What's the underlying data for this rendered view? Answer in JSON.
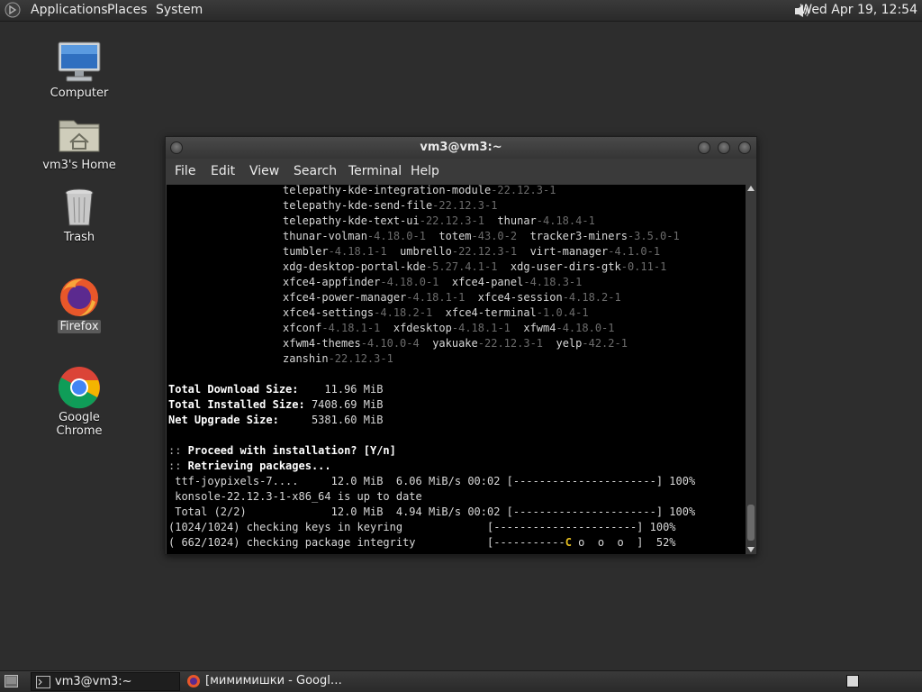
{
  "top_panel": {
    "menus": [
      "Applications",
      "Places",
      "System"
    ],
    "clock": "Wed Apr 19, 12:54",
    "icons": {
      "apps": "gnome-foot-icon",
      "volume": "speaker-icon"
    }
  },
  "desktop": {
    "icons": [
      {
        "label": "Computer",
        "icon": "computer-icon"
      },
      {
        "label": "vm3's Home",
        "icon": "home-folder-icon"
      },
      {
        "label": "Trash",
        "icon": "trash-icon"
      },
      {
        "label": "Firefox",
        "icon": "firefox-icon"
      },
      {
        "label": "Google Chrome",
        "icon": "chrome-icon"
      }
    ]
  },
  "window": {
    "title": "vm3@vm3:~",
    "menu": [
      "File",
      "Edit",
      "View",
      "Search",
      "Terminal",
      "Help"
    ],
    "package_lines": [
      [
        [
          "telepathy-kde-integration-module",
          "-22.12.3-1"
        ]
      ],
      [
        [
          "telepathy-kde-send-file",
          "-22.12.3-1"
        ]
      ],
      [
        [
          "telepathy-kde-text-ui",
          "-22.12.3-1"
        ],
        [
          "thunar",
          "-4.18.4-1"
        ]
      ],
      [
        [
          "thunar-volman",
          "-4.18.0-1"
        ],
        [
          "totem",
          "-43.0-2"
        ],
        [
          "tracker3-miners",
          "-3.5.0-1"
        ]
      ],
      [
        [
          "tumbler",
          "-4.18.1-1"
        ],
        [
          "umbrello",
          "-22.12.3-1"
        ],
        [
          "virt-manager",
          "-4.1.0-1"
        ]
      ],
      [
        [
          "xdg-desktop-portal-kde",
          "-5.27.4.1-1"
        ],
        [
          "xdg-user-dirs-gtk",
          "-0.11-1"
        ]
      ],
      [
        [
          "xfce4-appfinder",
          "-4.18.0-1"
        ],
        [
          "xfce4-panel",
          "-4.18.3-1"
        ]
      ],
      [
        [
          "xfce4-power-manager",
          "-4.18.1-1"
        ],
        [
          "xfce4-session",
          "-4.18.2-1"
        ]
      ],
      [
        [
          "xfce4-settings",
          "-4.18.2-1"
        ],
        [
          "xfce4-terminal",
          "-1.0.4-1"
        ]
      ],
      [
        [
          "xfconf",
          "-4.18.1-1"
        ],
        [
          "xfdesktop",
          "-4.18.1-1"
        ],
        [
          "xfwm4",
          "-4.18.0-1"
        ]
      ],
      [
        [
          "xfwm4-themes",
          "-4.10.0-4"
        ],
        [
          "yakuake",
          "-22.12.3-1"
        ],
        [
          "yelp",
          "-42.2-1"
        ]
      ],
      [
        [
          "zanshin",
          "-22.12.3-1"
        ]
      ]
    ],
    "sizes": [
      {
        "label": "Total Download Size:",
        "value": "    11.96 MiB"
      },
      {
        "label": "Total Installed Size:",
        "value": " 7408.69 MiB"
      },
      {
        "label": "Net Upgrade Size:",
        "value": "     5381.60 MiB"
      }
    ],
    "prompt": {
      "marker": "::",
      "text": " Proceed with installation? [Y/n]"
    },
    "retrieving": {
      "marker": "::",
      "text": " Retrieving packages..."
    },
    "progress_lines": [
      {
        "text": " ttf-joypixels-7....     12.0 MiB  6.06 MiB/s 00:02 [----------------------] 100%"
      },
      {
        "text": " konsole-22.12.3-1-x86_64 is up to date"
      },
      {
        "text": " Total (2/2)             12.0 MiB  4.94 MiB/s 00:02 [----------------------] 100%"
      },
      {
        "text": "(1024/1024) checking keys in keyring             [----------------------] 100%"
      },
      {
        "text_before": "( 662/1024) checking package integrity           [-----------",
        "pacman": "C",
        "text_after": " o  o  o  ]  52%"
      }
    ],
    "integrity_progress_percent": 52
  },
  "bottom_panel": {
    "tasks": [
      {
        "label": "vm3@vm3:~",
        "icon": "terminal-icon"
      },
      {
        "label": "[мимимишки - Googl…",
        "icon": "firefox-icon"
      }
    ]
  }
}
